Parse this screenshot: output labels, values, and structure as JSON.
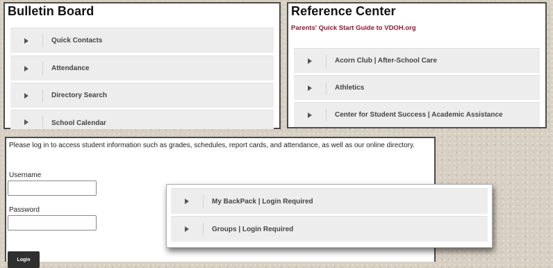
{
  "bulletin": {
    "title": "Bulletin Board",
    "items": [
      {
        "label": "Quick Contacts"
      },
      {
        "label": "Attendance"
      },
      {
        "label": "Directory Search"
      },
      {
        "label": "School Calendar"
      }
    ]
  },
  "reference": {
    "title": "Reference Center",
    "link": "Parents' Quick Start Guide to VDOH.org",
    "items": [
      {
        "label": "Acorn Club | After-School Care"
      },
      {
        "label": "Athletics"
      },
      {
        "label": "Center for Student Success | Academic Assistance"
      }
    ]
  },
  "login": {
    "intro": "Please log in to access student information such as grades, schedules, report cards, and attendance, as well as our online directory.",
    "username_label": "Username",
    "username_value": "",
    "password_label": "Password",
    "password_value": "",
    "button_label": "Login"
  },
  "protected": {
    "items": [
      {
        "label": "My BackPack | Login Required"
      },
      {
        "label": "Groups | Login Required"
      }
    ]
  },
  "colors": {
    "accent_link": "#8b1a2e",
    "accordion_bg": "#ededed",
    "button_bg": "#2f2f2f"
  },
  "icons": {
    "accordion": "caret-right-icon"
  }
}
